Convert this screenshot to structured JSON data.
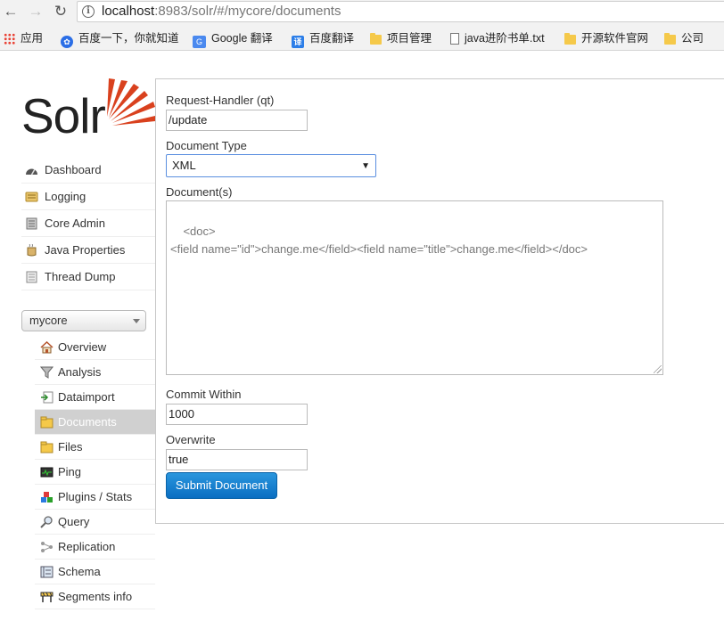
{
  "browser": {
    "url_host": "localhost",
    "url_rest": ":8983/solr/#/mycore/documents",
    "bookmarks": [
      {
        "label": "应用",
        "icon": "apps-grid-icon"
      },
      {
        "label": "百度一下，你就知道",
        "icon": "baidu-paw-icon"
      },
      {
        "label": "Google 翻译",
        "icon": "google-translate-icon"
      },
      {
        "label": "百度翻译",
        "icon": "baidu-translate-icon"
      },
      {
        "label": "项目管理",
        "icon": "folder-icon"
      },
      {
        "label": "java进阶书单.txt",
        "icon": "document-icon"
      },
      {
        "label": "开源软件官网",
        "icon": "folder-icon"
      },
      {
        "label": "公司",
        "icon": "folder-icon"
      }
    ]
  },
  "logo": {
    "text": "Solr"
  },
  "nav": {
    "items": [
      {
        "label": "Dashboard",
        "icon": "dashboard-icon"
      },
      {
        "label": "Logging",
        "icon": "logging-icon"
      },
      {
        "label": "Core Admin",
        "icon": "core-admin-icon"
      },
      {
        "label": "Java Properties",
        "icon": "java-properties-icon"
      },
      {
        "label": "Thread Dump",
        "icon": "thread-dump-icon"
      }
    ]
  },
  "core_selector": {
    "value": "mycore"
  },
  "core_nav": {
    "items": [
      {
        "label": "Overview",
        "icon": "house-icon"
      },
      {
        "label": "Analysis",
        "icon": "funnel-icon"
      },
      {
        "label": "Dataimport",
        "icon": "import-icon"
      },
      {
        "label": "Documents",
        "icon": "documents-icon",
        "active": true
      },
      {
        "label": "Files",
        "icon": "files-icon"
      },
      {
        "label": "Ping",
        "icon": "ping-icon"
      },
      {
        "label": "Plugins / Stats",
        "icon": "plugins-icon"
      },
      {
        "label": "Query",
        "icon": "magnifier-icon"
      },
      {
        "label": "Replication",
        "icon": "replication-icon"
      },
      {
        "label": "Schema",
        "icon": "schema-icon"
      },
      {
        "label": "Segments info",
        "icon": "segments-icon"
      }
    ]
  },
  "form": {
    "handler_label": "Request-Handler (qt)",
    "handler_value": "/update",
    "doctype_label": "Document Type",
    "doctype_value": "XML",
    "documents_label": "Document(s)",
    "documents_value": "<doc>\n<field name=\"id\">change.me</field><field name=\"title\">change.me</field></doc>",
    "commit_label": "Commit Within",
    "commit_value": "1000",
    "overwrite_label": "Overwrite",
    "overwrite_value": "true",
    "submit_label": "Submit Document"
  },
  "colors": {
    "accent": "#0a6ec2",
    "logo_sun": "#d9411e",
    "active_item_bg": "#d0d0d0"
  }
}
